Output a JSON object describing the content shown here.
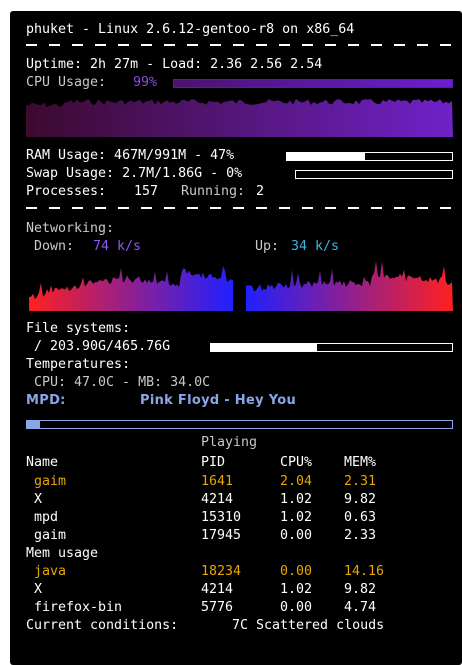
{
  "header": {
    "title": "phuket - Linux 2.6.12-gentoo-r8 on x86_64"
  },
  "uptime_line": "Uptime: 2h 27m - Load: 2.36 2.56 2.54",
  "cpu": {
    "label": "CPU Usage:",
    "percent_text": "99%",
    "percent": 99,
    "graph_colors": {
      "from": "#3b0a2e",
      "to": "#6f22c8"
    }
  },
  "memory": {
    "ram_line": "RAM Usage: 467M/991M - 47%",
    "ram_percent": 47,
    "swap_line": "Swap Usage: 2.7M/1.86G - 0%",
    "swap_percent": 0,
    "processes_label": "Processes:",
    "processes_value": "157",
    "running_label": "Running:",
    "running_value": "2"
  },
  "network": {
    "label": "Networking:",
    "down_label": "Down:",
    "down_value": "74 k/s",
    "up_label": "Up:",
    "up_value": "34 k/s",
    "graph_colors": {
      "from": "#ff2020",
      "to": "#2020ff"
    }
  },
  "filesystems": {
    "label": "File systems:",
    "root_line": "/ 203.90G/465.76G",
    "root_percent": 44
  },
  "temperatures": {
    "label": "Temperatures:",
    "line": "CPU: 47.0C - MB: 34.0C"
  },
  "mpd": {
    "label": "MPD:",
    "song": "Pink Floyd - Hey You",
    "status": "Playing",
    "progress": 3
  },
  "top_cpu": {
    "headers": [
      "Name",
      "PID",
      "CPU%",
      "MEM%"
    ],
    "rows": [
      {
        "name": "gaim",
        "pid": "1641",
        "cpu": "2.04",
        "mem": "2.31",
        "highlight": true
      },
      {
        "name": "X",
        "pid": "4214",
        "cpu": "1.02",
        "mem": "9.82",
        "highlight": false
      },
      {
        "name": "mpd",
        "pid": "15310",
        "cpu": "1.02",
        "mem": "0.63",
        "highlight": false
      },
      {
        "name": "gaim",
        "pid": "17945",
        "cpu": "0.00",
        "mem": "2.33",
        "highlight": false
      }
    ]
  },
  "top_mem": {
    "label": "Mem usage",
    "rows": [
      {
        "name": "java",
        "pid": "18234",
        "cpu": "0.00",
        "mem": "14.16",
        "highlight": true
      },
      {
        "name": "X",
        "pid": "4214",
        "cpu": "1.02",
        "mem": "9.82",
        "highlight": false
      },
      {
        "name": "firefox-bin",
        "pid": "5776",
        "cpu": "0.00",
        "mem": "4.74",
        "highlight": false
      }
    ]
  },
  "weather": {
    "label": "Current conditions:",
    "value": "7C Scattered clouds"
  },
  "colors": {
    "background": "#000000",
    "text": "#ffffff",
    "highlight": "#e6a700",
    "mpd": "#8aa6e6"
  }
}
